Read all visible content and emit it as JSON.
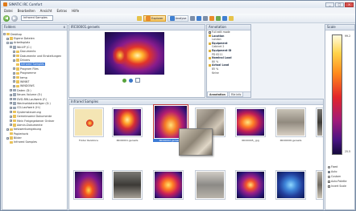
{
  "window": {
    "title": "SIMATIC IRC Comfort"
  },
  "menu": [
    "Datei",
    "Bearbeiten",
    "Ansicht",
    "Extras",
    "Hilfe"
  ],
  "toolbar": {
    "back": "◀",
    "forward": "▶",
    "address": "Infrared Samples",
    "buttons": [
      {
        "label": "Explorer",
        "active": true
      },
      {
        "label": "Analyse",
        "active": false
      }
    ]
  },
  "folders": {
    "title": "Folders",
    "close": "x",
    "tree": [
      {
        "indent": 0,
        "expander": "-",
        "label": "Desktop",
        "icon": "folder"
      },
      {
        "indent": 1,
        "expander": "+",
        "label": "Eigene Dateien",
        "icon": "folder"
      },
      {
        "indent": 1,
        "expander": "-",
        "label": "Arbeitsplatz",
        "icon": "drive"
      },
      {
        "indent": 2,
        "expander": "-",
        "label": "WinXP (C:)",
        "icon": "drive"
      },
      {
        "indent": 3,
        "expander": "+",
        "label": "Documents",
        "icon": "folder"
      },
      {
        "indent": 3,
        "expander": "+",
        "label": "Dokumente und Einstellungen",
        "icon": "folder"
      },
      {
        "indent": 3,
        "expander": "+",
        "label": "Drivers",
        "icon": "folder"
      },
      {
        "indent": 3,
        "expander": "",
        "label": "Infrared Samples",
        "icon": "folder",
        "selected": true
      },
      {
        "indent": 3,
        "expander": "+",
        "label": "Program Files",
        "icon": "folder"
      },
      {
        "indent": 3,
        "expander": "+",
        "label": "Programme",
        "icon": "folder"
      },
      {
        "indent": 3,
        "expander": "+",
        "label": "temp",
        "icon": "folder"
      },
      {
        "indent": 3,
        "expander": "+",
        "label": "WINNT",
        "icon": "folder"
      },
      {
        "indent": 3,
        "expander": "+",
        "label": "WINDOWS",
        "icon": "folder"
      },
      {
        "indent": 2,
        "expander": "+",
        "label": "Daten (D:)",
        "icon": "drive"
      },
      {
        "indent": 2,
        "expander": "+",
        "label": "Neues Volume (E:)",
        "icon": "drive"
      },
      {
        "indent": 2,
        "expander": "+",
        "label": "DVD-RW-Laufwerk (F:)",
        "icon": "drive"
      },
      {
        "indent": 2,
        "expander": "+",
        "label": "Wechseldatenträger (G:)",
        "icon": "drive"
      },
      {
        "indent": 2,
        "expander": "+",
        "label": "CD-Laufwerk (H:)",
        "icon": "drive"
      },
      {
        "indent": 2,
        "expander": "+",
        "label": "Systemsteuerung",
        "icon": "folder"
      },
      {
        "indent": 2,
        "expander": "+",
        "label": "Gemeinsame Dokumente",
        "icon": "folder"
      },
      {
        "indent": 2,
        "expander": "+",
        "label": "Mein Freigegebener Ordner",
        "icon": "folder"
      },
      {
        "indent": 2,
        "expander": "+",
        "label": "Admin-Dokumente",
        "icon": "folder"
      },
      {
        "indent": 1,
        "expander": "+",
        "label": "Netzwerkumgebung",
        "icon": "folder"
      },
      {
        "indent": 1,
        "expander": "",
        "label": "Papierkorb",
        "icon": "folder"
      },
      {
        "indent": 1,
        "expander": "+",
        "label": "Bilder",
        "icon": "folder"
      },
      {
        "indent": 1,
        "expander": "",
        "label": "Infrared Samples",
        "icon": "folder"
      }
    ]
  },
  "preview": {
    "title": "IRC00001.geraets"
  },
  "info": {
    "title": "Annotation",
    "rows": [
      {
        "type": "check",
        "text": "Full edit mode"
      },
      {
        "type": "key",
        "text": "Location"
      },
      {
        "type": "val",
        "text": "London"
      },
      {
        "type": "key",
        "text": "Equipment"
      },
      {
        "type": "val",
        "text": "Cabinet 2"
      },
      {
        "type": "key",
        "text": "Equipment ID"
      },
      {
        "type": "val",
        "text": "PD 8211"
      },
      {
        "type": "key",
        "text": "Nominal Load"
      },
      {
        "type": "val",
        "text": "80 %"
      },
      {
        "type": "key",
        "text": "Actual Load"
      },
      {
        "type": "val",
        "text": "85 %"
      },
      {
        "type": "val",
        "text": "Keine"
      }
    ],
    "tabs": [
      {
        "label": "Annotation",
        "active": true
      },
      {
        "label": "File info",
        "active": false
      }
    ]
  },
  "gallery": {
    "title": "Infrared Samples",
    "captions": [
      "Folder Relations",
      "IRC00001.geraets",
      "IRC00002.geraets",
      "",
      "IRC00005_.jpg",
      "IRC00006.geraets",
      "IRC00007_.jpg"
    ]
  },
  "scale": {
    "title": "Scale",
    "top": "99.2",
    "bottom": "25.5",
    "options": [
      {
        "type": "radio",
        "label": "Fixed",
        "on": false
      },
      {
        "type": "radio",
        "label": "Auto",
        "on": true
      },
      {
        "type": "radio",
        "label": "Custom",
        "on": false
      },
      {
        "type": "check",
        "label": "Auto Palette"
      },
      {
        "type": "check",
        "label": "Invert Scale"
      }
    ]
  }
}
